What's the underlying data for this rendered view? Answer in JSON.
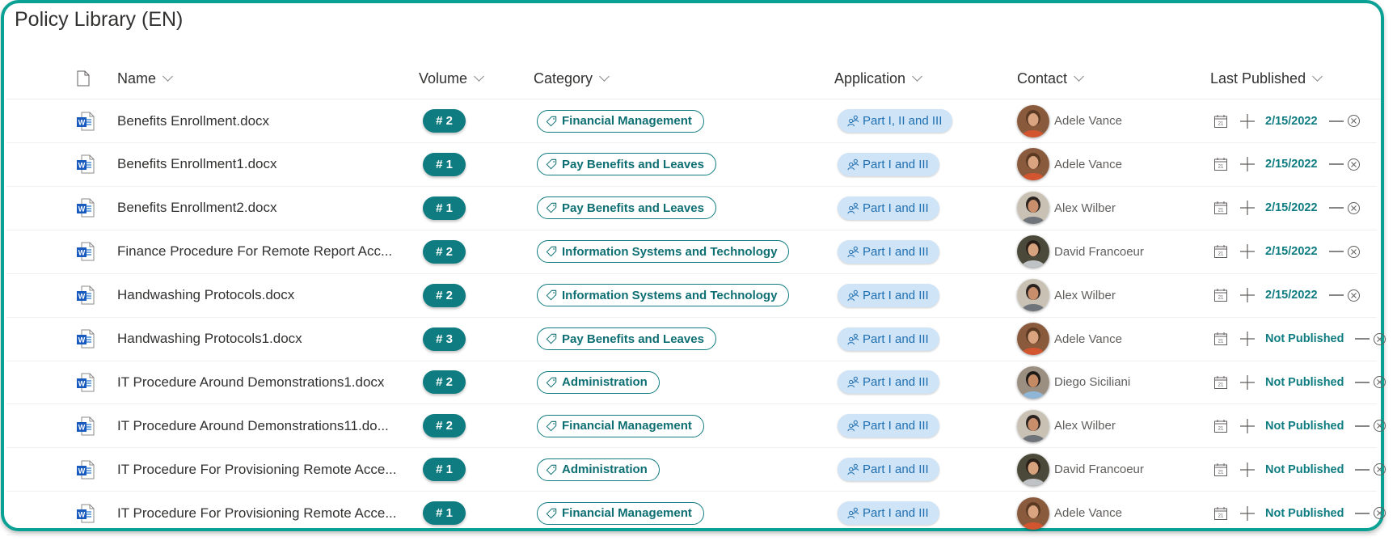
{
  "page": {
    "title": "Policy Library (EN)"
  },
  "colors": {
    "frame_border": "#0aa195",
    "accent_teal": "#0e7c80",
    "app_pill_bg": "#cfe4f7",
    "app_pill_text": "#1f6fb0"
  },
  "columns": [
    {
      "id": "file-type",
      "label": "",
      "icon": "document-icon"
    },
    {
      "id": "name",
      "label": "Name"
    },
    {
      "id": "volume",
      "label": "Volume"
    },
    {
      "id": "category",
      "label": "Category"
    },
    {
      "id": "application",
      "label": "Application"
    },
    {
      "id": "contact",
      "label": "Contact"
    },
    {
      "id": "last-published",
      "label": "Last Published"
    }
  ],
  "rows": [
    {
      "icon": "word-doc-icon",
      "name": "Benefits Enrollment.docx",
      "volume": "# 2",
      "category": "Financial Management",
      "application": "Part I, II and III",
      "contact": "Adele Vance",
      "last_published": "2/15/2022"
    },
    {
      "icon": "word-doc-icon",
      "name": "Benefits Enrollment1.docx",
      "volume": "# 1",
      "category": "Pay Benefits and Leaves",
      "application": "Part I and III",
      "contact": "Adele Vance",
      "last_published": "2/15/2022"
    },
    {
      "icon": "word-doc-icon",
      "name": "Benefits Enrollment2.docx",
      "volume": "# 1",
      "category": "Pay Benefits and Leaves",
      "application": "Part I and III",
      "contact": "Alex Wilber",
      "last_published": "2/15/2022"
    },
    {
      "icon": "word-doc-icon",
      "name": "Finance Procedure For Remote Report Acc...",
      "volume": "# 2",
      "category": "Information Systems and Technology",
      "application": "Part I and III",
      "contact": "David Francoeur",
      "last_published": "2/15/2022"
    },
    {
      "icon": "word-doc-icon",
      "name": "Handwashing Protocols.docx",
      "volume": "# 2",
      "category": "Information Systems and Technology",
      "application": "Part I and III",
      "contact": "Alex Wilber",
      "last_published": "2/15/2022"
    },
    {
      "icon": "word-doc-icon",
      "name": "Handwashing Protocols1.docx",
      "volume": "# 3",
      "category": "Pay Benefits and Leaves",
      "application": "Part I and III",
      "contact": "Adele Vance",
      "last_published": "Not Published"
    },
    {
      "icon": "word-doc-icon",
      "name": "IT Procedure Around Demonstrations1.docx",
      "volume": "# 2",
      "category": "Administration",
      "application": "Part I and III",
      "contact": "Diego Siciliani",
      "last_published": "Not Published"
    },
    {
      "icon": "word-doc-icon",
      "name": "IT Procedure Around Demonstrations11.do...",
      "volume": "# 2",
      "category": "Financial Management",
      "application": "Part I and III",
      "contact": "Alex Wilber",
      "last_published": "Not Published"
    },
    {
      "icon": "word-doc-icon",
      "name": "IT Procedure For Provisioning Remote Acce...",
      "volume": "# 1",
      "category": "Administration",
      "application": "Part I and III",
      "contact": "David Francoeur",
      "last_published": "Not Published"
    },
    {
      "icon": "word-doc-icon",
      "name": "IT Procedure For Provisioning Remote Acce...",
      "volume": "# 1",
      "category": "Financial Management",
      "application": "Part I and III",
      "contact": "Adele Vance",
      "last_published": "Not Published"
    }
  ],
  "avatars": {
    "Adele Vance": {
      "bg": "#8a5a3c",
      "face": "#d9a47f",
      "hair": "#5b3a24",
      "shirt": "#d2552f"
    },
    "Alex Wilber": {
      "bg": "#c9c2b4",
      "face": "#c98f6c",
      "hair": "#2b2320",
      "shirt": "#6e7479"
    },
    "David Francoeur": {
      "bg": "#4b4a3a",
      "face": "#d7a27e",
      "hair": "#2a1f18",
      "shirt": "#c0c3c6"
    },
    "Diego Siciliani": {
      "bg": "#9a8f80",
      "face": "#c48a64",
      "hair": "#1e1a18",
      "shirt": "#8fb6d6"
    }
  }
}
